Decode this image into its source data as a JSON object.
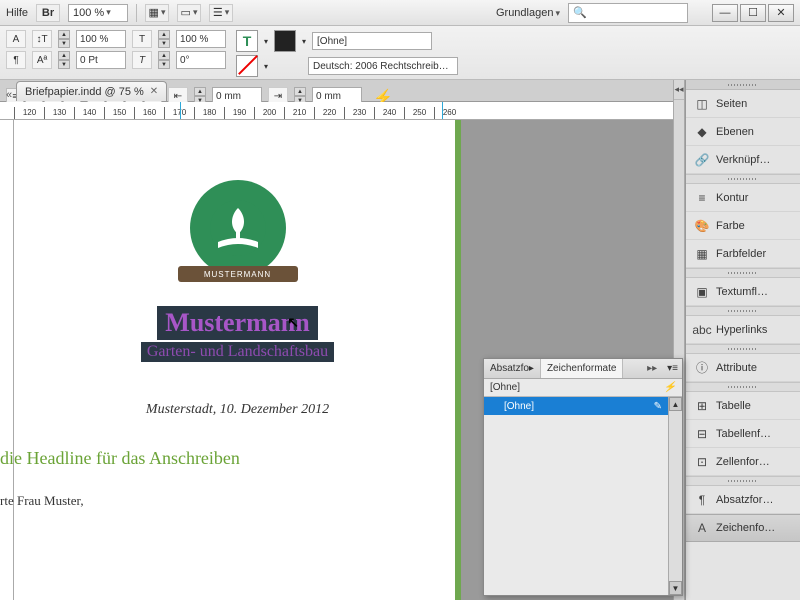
{
  "top": {
    "help": "Hilfe",
    "br": "Br",
    "zoom": "100 %",
    "workspace_label": "Grundlagen",
    "search_placeholder": "🔍"
  },
  "win": {
    "min": "—",
    "max": "☐",
    "close": "✕"
  },
  "ctrl": {
    "pct1": "100 %",
    "pct2": "100 %",
    "pt": "0 Pt",
    "deg": "0°",
    "style": "[Ohne]",
    "lang": "Deutsch: 2006 Rechtschreib…",
    "mm": "0 mm"
  },
  "tab": {
    "label": "Briefpapier.indd @ 75 %"
  },
  "ruler": [
    "120",
    "130",
    "140",
    "150",
    "160",
    "170",
    "180",
    "190",
    "200",
    "210",
    "220",
    "230",
    "240",
    "250",
    "260"
  ],
  "doc": {
    "logotext": "MUSTERMANN",
    "name": "Mustermann",
    "sub": "Garten- und Landschaftsbau",
    "date": "Musterstadt, 10. Dezember 2012",
    "headline": "die Headline für das Anschreiben",
    "salut": "rte Frau Muster,"
  },
  "floatpanel": {
    "tab1": "Absatzfo",
    "tab2": "Zeichenformate",
    "arrows": "▸▸",
    "base": "[Ohne]",
    "item": "[Ohne]"
  },
  "dock": {
    "items": [
      {
        "icon": "◫",
        "label": "Seiten"
      },
      {
        "icon": "◆",
        "label": "Ebenen"
      },
      {
        "icon": "🔗",
        "label": "Verknüpf…"
      }
    ],
    "g2": [
      {
        "icon": "≡",
        "label": "Kontur"
      },
      {
        "icon": "🎨",
        "label": "Farbe"
      },
      {
        "icon": "▦",
        "label": "Farbfelder"
      }
    ],
    "g3": [
      {
        "icon": "▣",
        "label": "Textumfl…"
      }
    ],
    "g4": [
      {
        "icon": "abc",
        "label": "Hyperlinks"
      }
    ],
    "g5": [
      {
        "icon": "ⓘ",
        "label": "Attribute"
      }
    ],
    "g6": [
      {
        "icon": "⊞",
        "label": "Tabelle"
      },
      {
        "icon": "⊟",
        "label": "Tabellenf…"
      },
      {
        "icon": "⊡",
        "label": "Zellenfor…"
      }
    ],
    "g7": [
      {
        "icon": "¶",
        "label": "Absatzfor…"
      },
      {
        "icon": "A",
        "label": "Zeichenfo…",
        "active": true
      }
    ]
  }
}
